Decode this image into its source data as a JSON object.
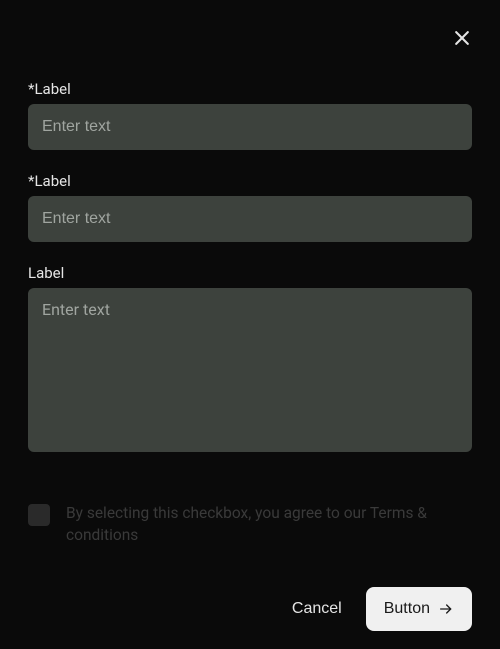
{
  "form": {
    "field1": {
      "label": "*Label",
      "placeholder": "Enter text",
      "value": ""
    },
    "field2": {
      "label": "*Label",
      "placeholder": "Enter text",
      "value": ""
    },
    "field3": {
      "label": "Label",
      "placeholder": "Enter text",
      "value": ""
    },
    "consent": {
      "text": "By selecting this checkbox, you agree to our Terms & conditions",
      "checked": false
    }
  },
  "buttons": {
    "cancel": "Cancel",
    "primary": "Button"
  }
}
